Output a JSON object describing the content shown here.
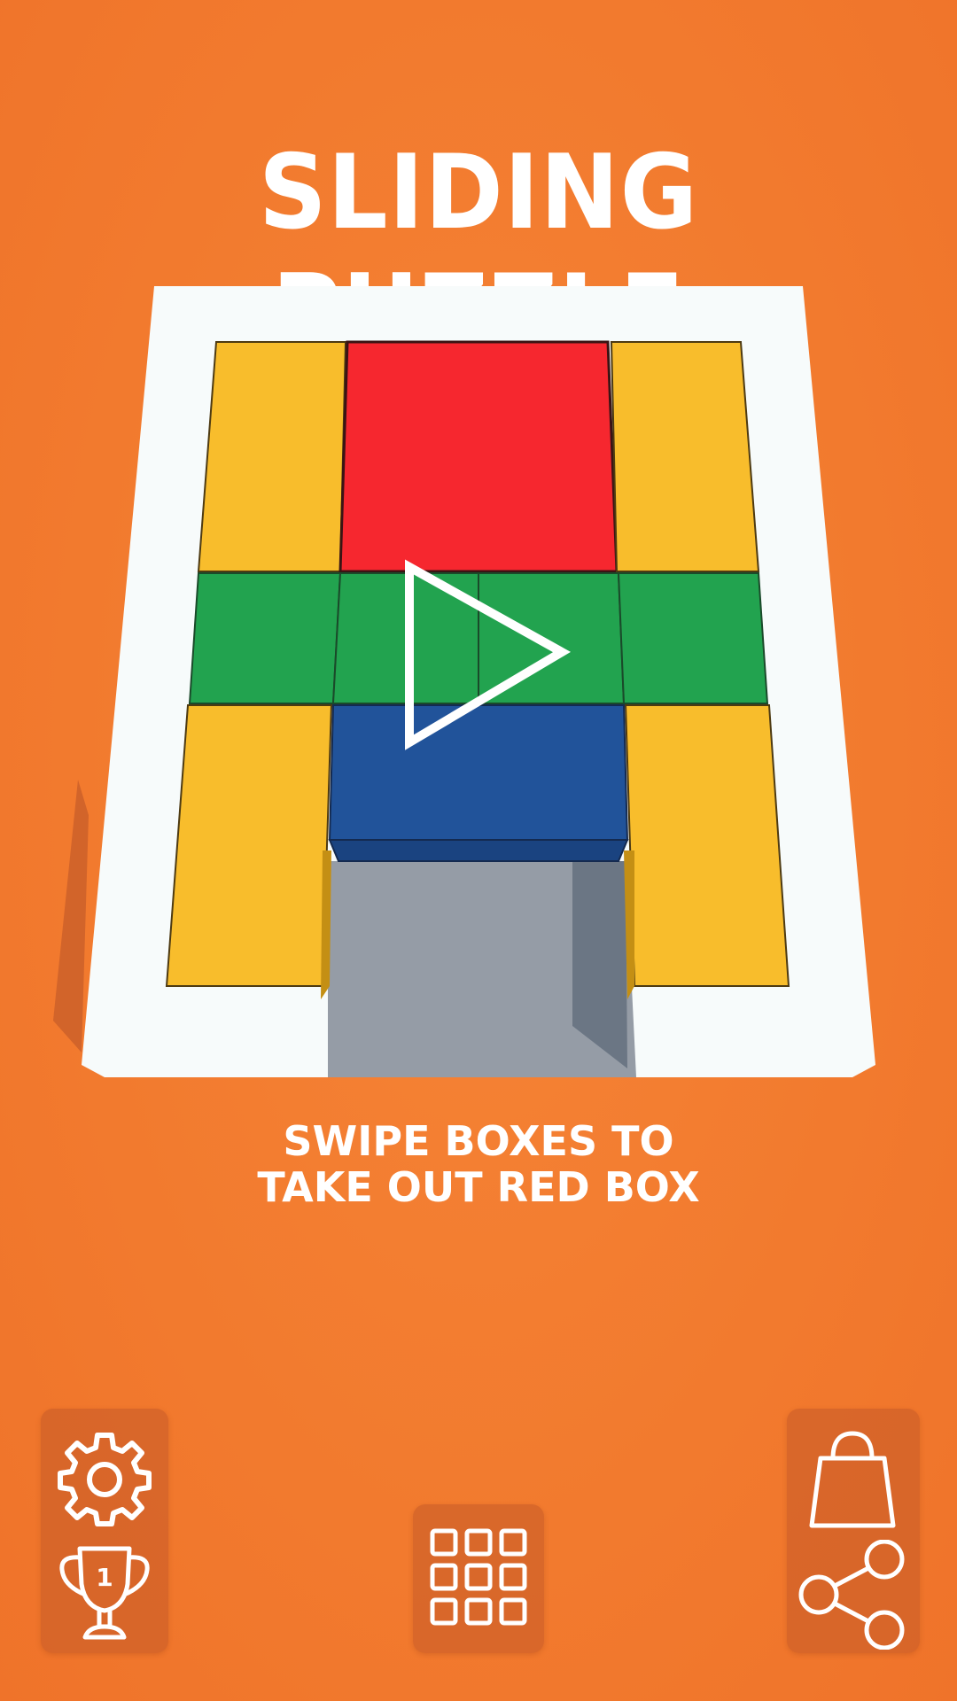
{
  "title": "Sliding Puzzle",
  "hint": {
    "line1": "Swipe Boxes to",
    "line2": "Take out Red Box"
  },
  "colors": {
    "background": "#f27a2e",
    "yellow_block": "#f8bd2c",
    "red_block": "#f6272f",
    "green_block": "#22a34f",
    "blue_block": "#21539a",
    "board": "#f7fbfb",
    "exit_slot": "#959ca6"
  },
  "buttons": {
    "settings": {
      "icon": "gear-icon"
    },
    "leaderboard": {
      "icon": "trophy-icon",
      "rank": "1"
    },
    "levels": {
      "icon": "grid-icon"
    },
    "shop": {
      "icon": "shopping-bag-icon"
    },
    "share": {
      "icon": "share-icon"
    },
    "play": {
      "icon": "play-icon"
    }
  }
}
